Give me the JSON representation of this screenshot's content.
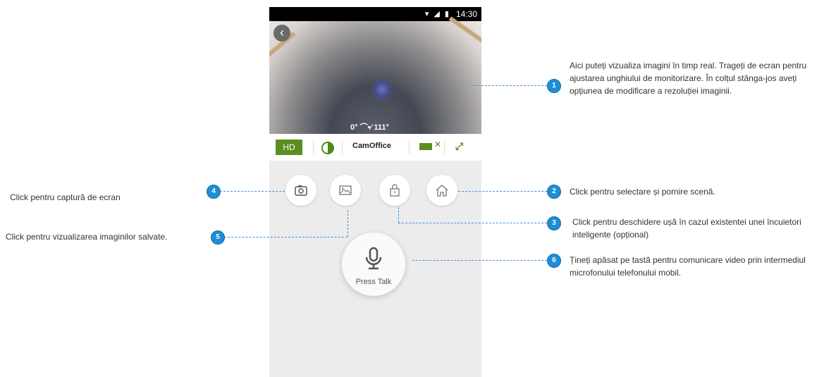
{
  "phone": {
    "status_time": "14:30",
    "status_icons": "wifi-signal-battery",
    "back_icon": "chevron-left-icon",
    "angle_left": "0°",
    "angle_right": "111°",
    "toolbar": {
      "hd_label": "HD",
      "device_name": "CamOffice"
    },
    "buttons": {
      "snapshot_icon": "camera-icon",
      "gallery_icon": "image-icon",
      "unlock_icon": "lock-icon",
      "home_icon": "home-icon"
    },
    "talk_label": "Press Talk",
    "accent_color": "#5b8e1e"
  },
  "annotations": {
    "a1": {
      "num": "1",
      "text": "Aici puteți vizualiza imagini în timp real. Trageți de ecran pentru ajustarea unghiului de monitorizare. În colțul stânga-jos aveți opțiunea de modificare a rezoluției imaginii."
    },
    "a2": {
      "num": "2",
      "text": "Click pentru selectare și pornire scenă."
    },
    "a3": {
      "num": "3",
      "text": "Click pentru deschidere ușă în cazul existentei unei încuietori inteligente (opțional)"
    },
    "a4": {
      "num": "4",
      "text": "Click pentru captură de ecran"
    },
    "a5": {
      "num": "5",
      "text": "Click pentru vizualizarea imaginilor salvate."
    },
    "a6": {
      "num": "6",
      "text": "Țineți apăsat pe tastă pentru comunicare video prin intermediul microfonului telefonului mobil."
    }
  },
  "badge_color": "#1f8ed4"
}
